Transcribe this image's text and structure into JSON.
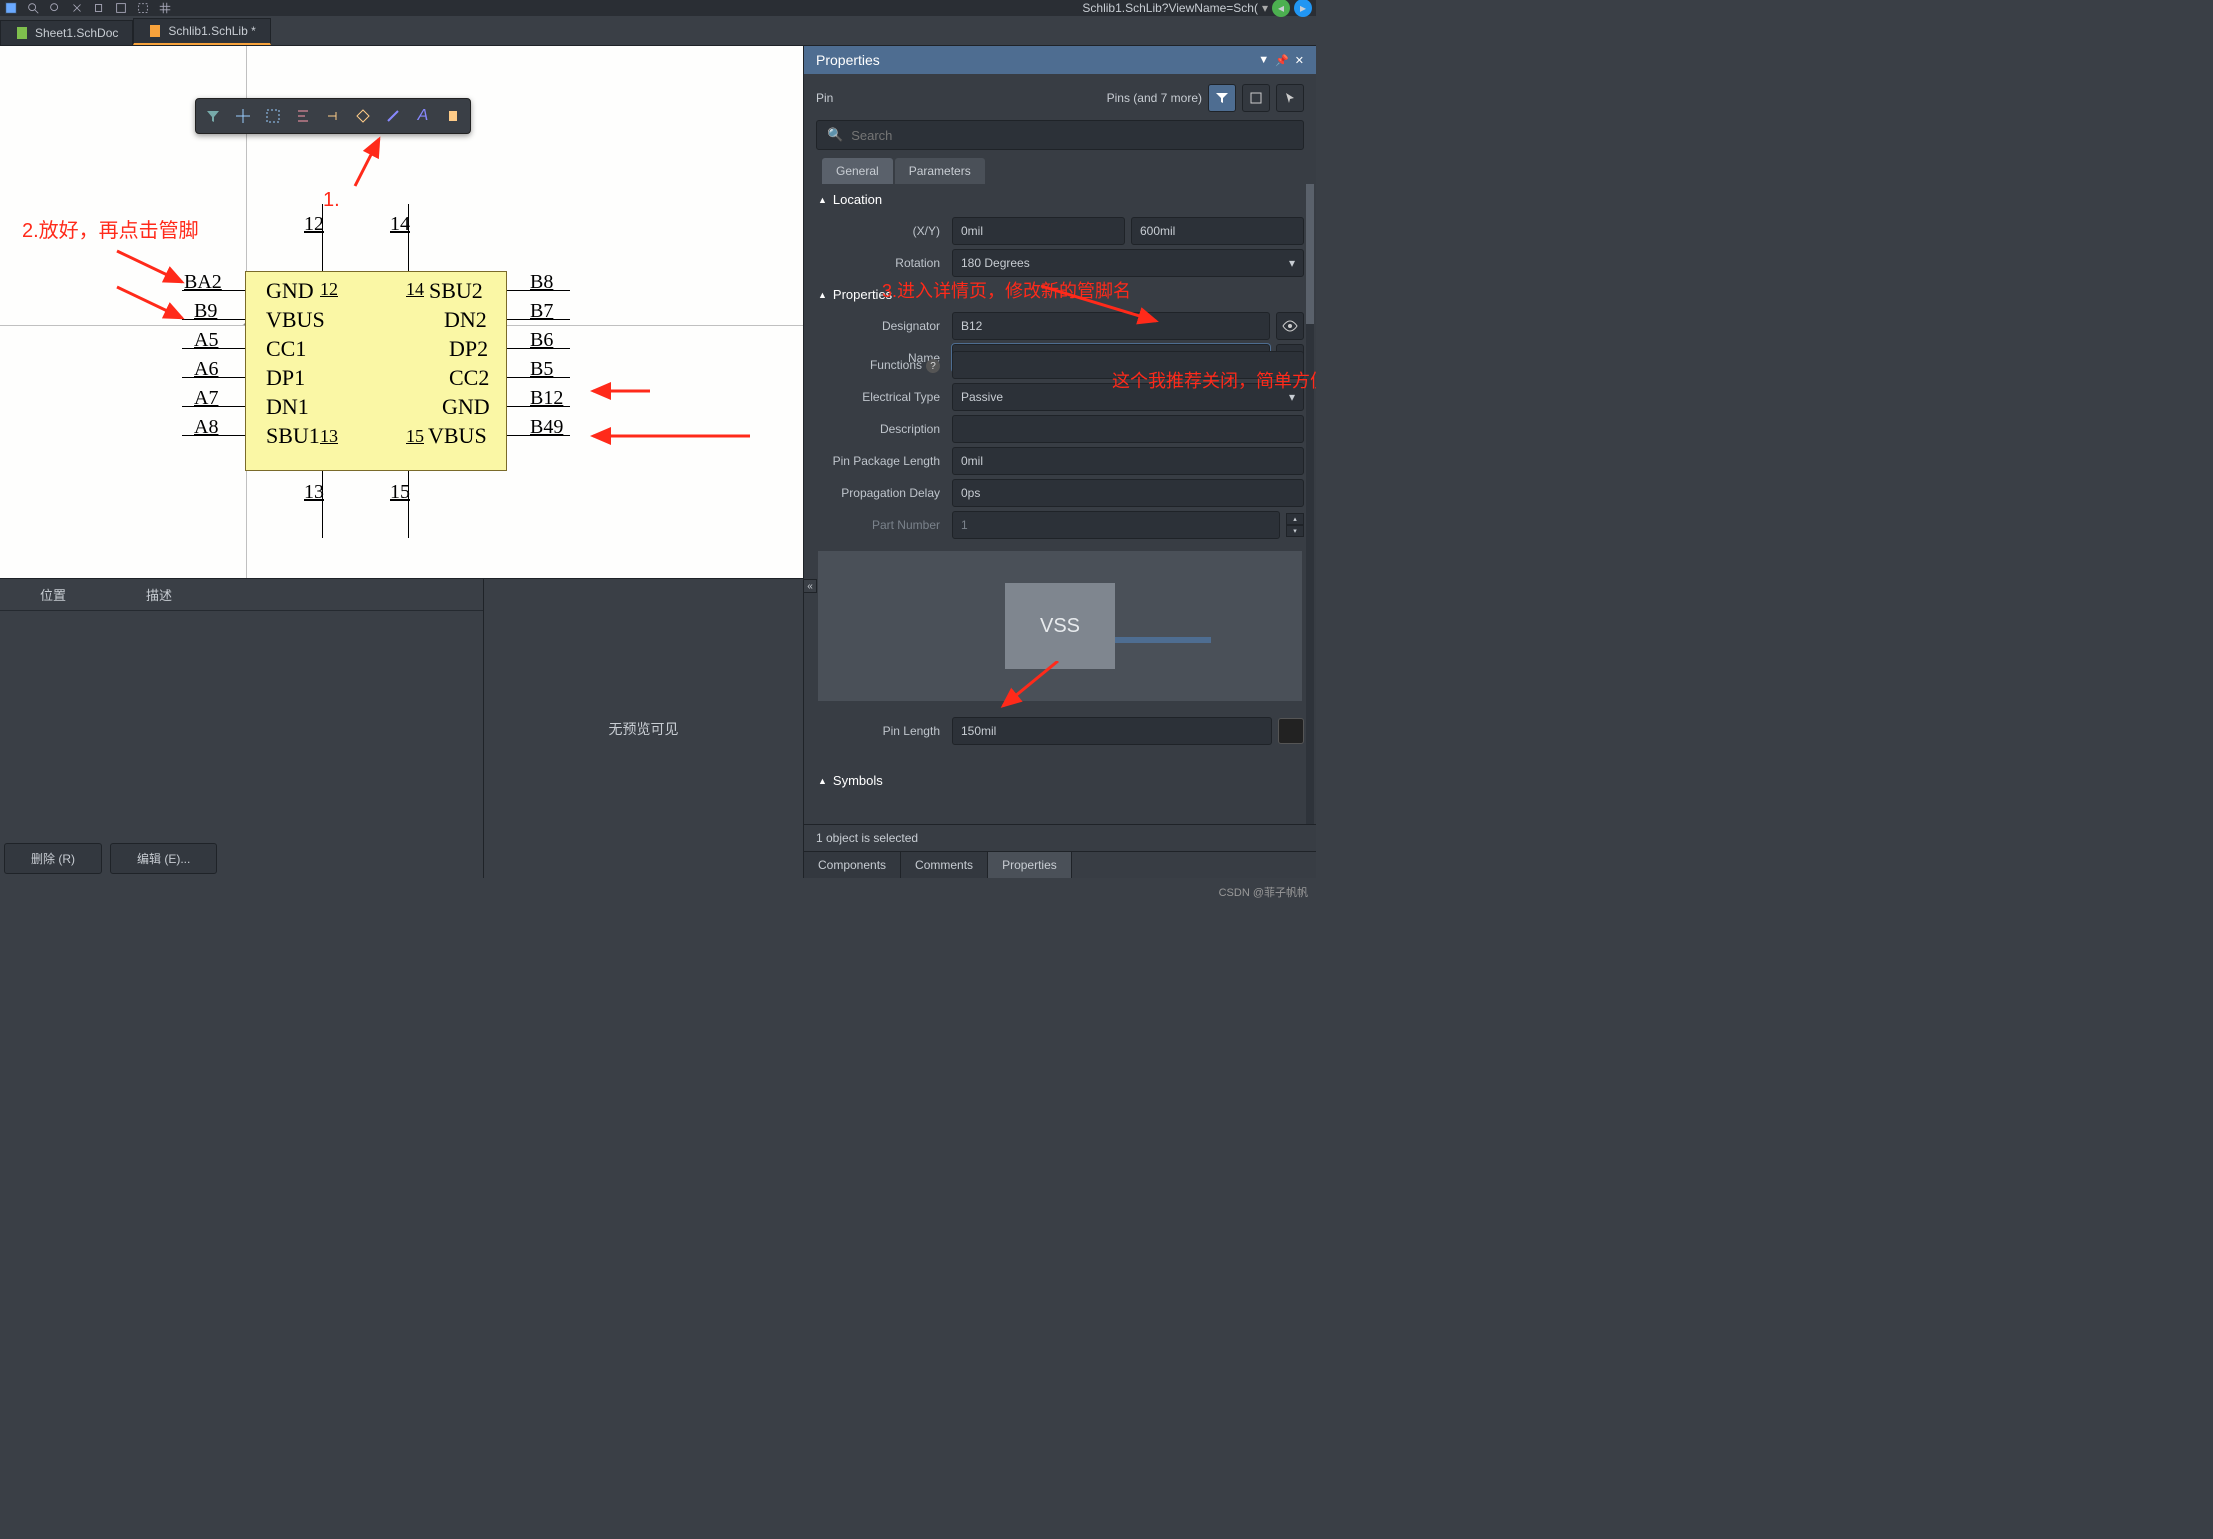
{
  "address_bar": "Schlib1.SchLib?ViewName=Sch(",
  "tabs": {
    "t0": "Sheet1.SchDoc",
    "t1": "Schlib1.SchLib *"
  },
  "annotations": {
    "a1": "1.",
    "a2": "2.放好，再点击管脚",
    "a3": "3.进入详情页，修改新的管脚名",
    "a4": "这个我推荐关闭，简单方便"
  },
  "component": {
    "left_pins": [
      "BA2",
      "B9",
      "A5",
      "A6",
      "A7",
      "A8"
    ],
    "right_pins": [
      "B8",
      "B7",
      "B6",
      "B5",
      "B12",
      "B49"
    ],
    "top_pins": [
      "12",
      "14"
    ],
    "bottom_pins": [
      "13",
      "15"
    ],
    "inner_left": [
      "GND",
      "VBUS",
      "CC1",
      "DP1",
      "DN1",
      "SBU1"
    ],
    "inner_right": [
      "SBU2",
      "DN2",
      "DP2",
      "CC2",
      "GND",
      "VBUS"
    ],
    "inner_num_tl": "12",
    "inner_num_tr": "14",
    "inner_num_bl": "13",
    "inner_num_br": "15"
  },
  "lower": {
    "col1": "位置",
    "col2": "描述",
    "nopreview": "无预览可见",
    "btn_del": "删除 (R)",
    "btn_edit": "编辑 (E)..."
  },
  "panel": {
    "title": "Properties",
    "pin": "Pin",
    "filter": "Pins (and 7 more)",
    "search_ph": "Search",
    "tab_general": "General",
    "tab_parameters": "Parameters",
    "sec_location": "Location",
    "sec_properties": "Properties",
    "sec_symbols": "Symbols",
    "lbl_xy": "(X/Y)",
    "lbl_rotation": "Rotation",
    "lbl_designator": "Designator",
    "lbl_name": "Name",
    "lbl_functions": "Functions",
    "lbl_etype": "Electrical Type",
    "lbl_desc": "Description",
    "lbl_pinlen": "Pin Package Length",
    "lbl_propdelay": "Propagation Delay",
    "lbl_partnum": "Part Number",
    "lbl_pinlength": "Pin Length",
    "val_x": "0mil",
    "val_y": "600mil",
    "val_rotation": "180 Degrees",
    "val_designator": "B12",
    "val_name": "",
    "val_etype": "Passive",
    "val_pinlen": "0mil",
    "val_propdelay": "0ps",
    "val_partnum": "1",
    "val_pinlength": "150mil",
    "preview_label": "VSS",
    "status": "1 object is selected",
    "bt_components": "Components",
    "bt_comments": "Comments",
    "bt_properties": "Properties"
  },
  "watermark": "CSDN @菲子帆帆"
}
